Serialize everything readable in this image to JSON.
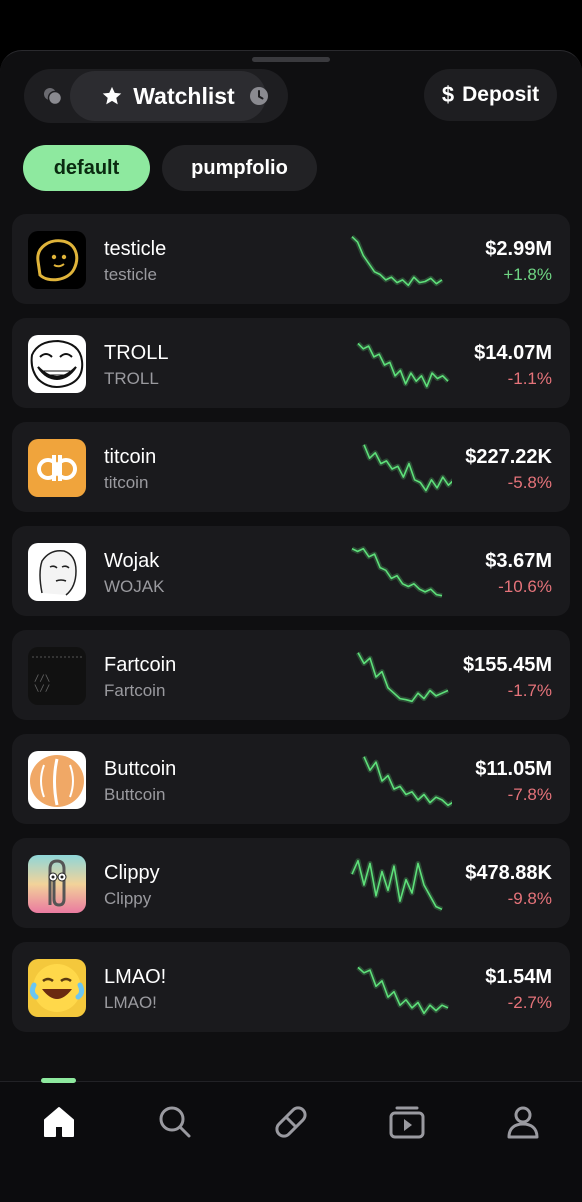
{
  "header": {
    "watchlist_label": "Watchlist",
    "deposit_label": "Deposit",
    "deposit_symbol": "$"
  },
  "tabs": [
    {
      "label": "default",
      "active": true
    },
    {
      "label": "pumpfolio",
      "active": false
    }
  ],
  "colors": {
    "accent": "#8ee99f",
    "up": "#6fd584",
    "down": "#e5737a",
    "sparkline": "#5ee07a"
  },
  "watchlist": [
    {
      "name": "testicle",
      "ticker": "testicle",
      "price": "$2.99M",
      "change": "+1.8%",
      "direction": "up",
      "icon": "potato-face-icon",
      "spark": [
        0.95,
        0.85,
        0.6,
        0.45,
        0.3,
        0.25,
        0.15,
        0.2,
        0.1,
        0.15,
        0.05,
        0.2,
        0.1,
        0.12,
        0.18,
        0.08,
        0.15
      ]
    },
    {
      "name": "TROLL",
      "ticker": "TROLL",
      "price": "$14.07M",
      "change": "-1.1%",
      "direction": "down",
      "icon": "trollface-icon",
      "spark": [
        0.9,
        0.8,
        0.85,
        0.65,
        0.7,
        0.5,
        0.55,
        0.3,
        0.4,
        0.15,
        0.35,
        0.2,
        0.3,
        0.1,
        0.35,
        0.25,
        0.3,
        0.2
      ]
    },
    {
      "name": "titcoin",
      "ticker": "titcoin",
      "price": "$227.22K",
      "change": "-5.8%",
      "direction": "down",
      "icon": "titcoin-icon",
      "spark": [
        0.95,
        0.7,
        0.8,
        0.6,
        0.65,
        0.5,
        0.55,
        0.35,
        0.6,
        0.3,
        0.25,
        0.1,
        0.3,
        0.15,
        0.35,
        0.2,
        0.3
      ]
    },
    {
      "name": "Wojak",
      "ticker": "WOJAK",
      "price": "$3.67M",
      "change": "-10.6%",
      "direction": "down",
      "icon": "wojak-icon",
      "spark": [
        0.95,
        0.9,
        0.95,
        0.8,
        0.85,
        0.6,
        0.55,
        0.4,
        0.45,
        0.3,
        0.25,
        0.3,
        0.2,
        0.15,
        0.2,
        0.1,
        0.08
      ]
    },
    {
      "name": "Fartcoin",
      "ticker": "Fartcoin",
      "price": "$155.45M",
      "change": "-1.7%",
      "direction": "down",
      "icon": "fartcoin-icon",
      "spark": [
        0.95,
        0.75,
        0.85,
        0.5,
        0.6,
        0.3,
        0.2,
        0.1,
        0.08,
        0.05,
        0.2,
        0.1,
        0.25,
        0.15,
        0.2,
        0.25
      ]
    },
    {
      "name": "Buttcoin",
      "ticker": "Buttcoin",
      "price": "$11.05M",
      "change": "-7.8%",
      "direction": "down",
      "icon": "buttcoin-icon",
      "spark": [
        0.95,
        0.7,
        0.85,
        0.5,
        0.6,
        0.35,
        0.4,
        0.25,
        0.3,
        0.15,
        0.25,
        0.1,
        0.2,
        0.15,
        0.05,
        0.12
      ]
    },
    {
      "name": "Clippy",
      "ticker": "Clippy",
      "price": "$478.88K",
      "change": "-9.8%",
      "direction": "down",
      "icon": "clippy-icon",
      "spark": [
        0.7,
        0.95,
        0.5,
        0.9,
        0.3,
        0.75,
        0.4,
        0.85,
        0.2,
        0.6,
        0.35,
        0.9,
        0.5,
        0.3,
        0.1,
        0.05
      ]
    },
    {
      "name": "LMAO!",
      "ticker": "LMAO!",
      "price": "$1.54M",
      "change": "-2.7%",
      "direction": "down",
      "icon": "laughing-emoji-icon",
      "spark": [
        0.9,
        0.8,
        0.85,
        0.55,
        0.65,
        0.35,
        0.45,
        0.2,
        0.3,
        0.15,
        0.25,
        0.05,
        0.2,
        0.1,
        0.2,
        0.15
      ]
    }
  ],
  "nav": [
    {
      "name": "home",
      "icon": "home-icon",
      "active": true
    },
    {
      "name": "search",
      "icon": "search-icon",
      "active": false
    },
    {
      "name": "pill",
      "icon": "pill-icon",
      "active": false
    },
    {
      "name": "media",
      "icon": "play-stack-icon",
      "active": false
    },
    {
      "name": "profile",
      "icon": "profile-icon",
      "active": false
    }
  ]
}
